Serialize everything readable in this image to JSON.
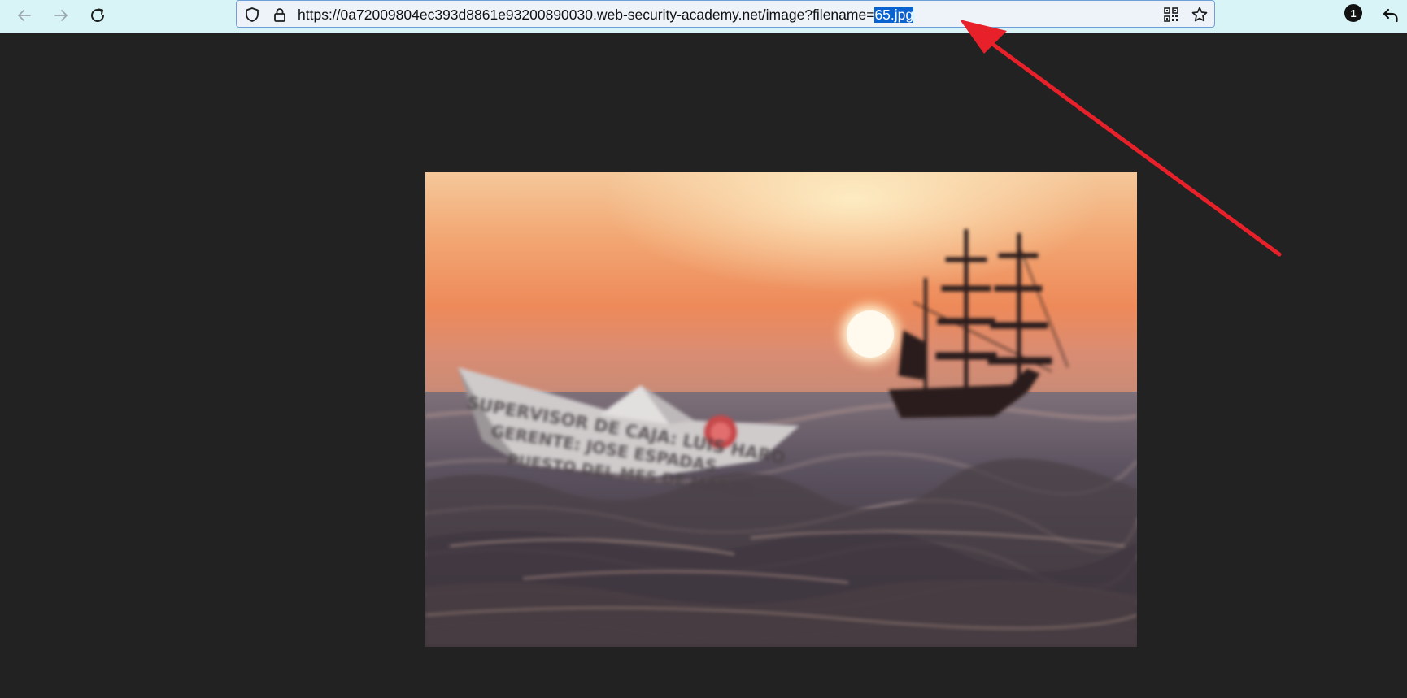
{
  "browser": {
    "url_prefix": "https://0a72009804ec393d8861e93200890030.web-security-academy.net/image?filename=",
    "url_selected": "65.jpg",
    "extensions_badge_count": "1",
    "icons": {
      "back": "arrow-left-icon",
      "forward": "arrow-right-icon",
      "reload": "reload-icon",
      "tracking_protection": "shield-icon",
      "site_security": "lock-icon",
      "qr_code": "qr-code-icon",
      "bookmark": "star-icon",
      "undo": "undo-arrow-icon"
    }
  },
  "page": {
    "image": {
      "subject": "paper-boat-and-sailing-ship-at-sunset",
      "boat_text_lines": [
        "SUPERVISOR DE CAJA: LUIS HARO",
        "GERENTE: JOSE ESPADAS",
        "PUESTO DEL MES DE MARZO"
      ]
    },
    "annotation_color": "#e8202a"
  }
}
